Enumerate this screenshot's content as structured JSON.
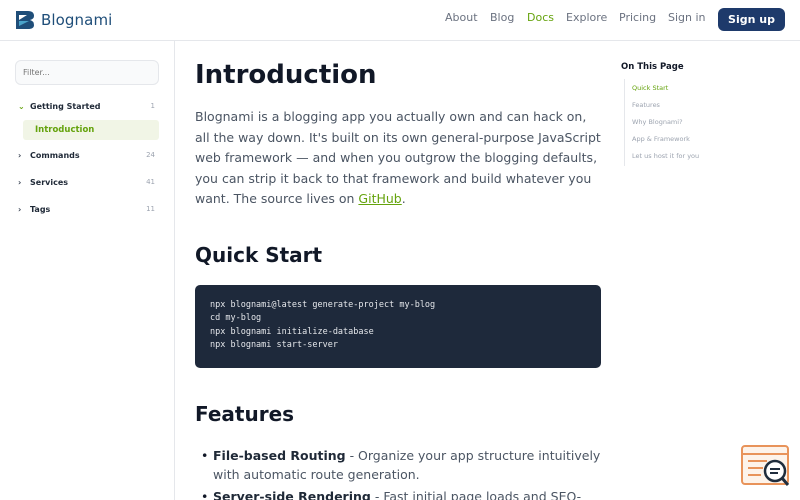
{
  "header": {
    "logo_text": "Blognami",
    "nav": [
      "About",
      "Blog",
      "Docs",
      "Explore",
      "Pricing",
      "Sign in"
    ],
    "active_nav": "Docs",
    "signup_label": "Sign up"
  },
  "sidebar": {
    "filter_placeholder": "Filter...",
    "items": [
      {
        "label": "Getting Started",
        "count": "1"
      },
      {
        "label": "Commands",
        "count": "24"
      },
      {
        "label": "Services",
        "count": "41"
      },
      {
        "label": "Tags",
        "count": "11"
      }
    ],
    "sub_item": "Introduction"
  },
  "main": {
    "title": "Introduction",
    "intro_text": "Blognami is a blogging app you actually own and can hack on, all the way down. It's built on its own general-purpose JavaScript web framework — and when you outgrow the blogging defaults, you can strip it back to that framework and build whatever you want. The source lives on ",
    "intro_link": "GitHub",
    "intro_end": ".",
    "quick_start_heading": "Quick Start",
    "code_lines": [
      "npx blognami@latest generate-project my-blog",
      "cd my-blog",
      "npx blognami initialize-database",
      "npx blognami start-server"
    ],
    "features_heading": "Features",
    "features": [
      {
        "bullet": "•",
        "title": "File-based Routing",
        "desc": " - Organize your app structure intuitively with automatic route generation."
      },
      {
        "bullet": "•",
        "title": "Server-side Rendering",
        "desc": " - Fast initial page loads and SEO-"
      }
    ]
  },
  "toc": {
    "title": "On This Page",
    "items": [
      "Quick Start",
      "Features",
      "Why Blognami?",
      "App & Framework",
      "Let us host it for you"
    ]
  },
  "colors": {
    "brand": "#1e3a6b",
    "accent": "#65a30d",
    "code_bg": "#1e293b"
  },
  "icons": {
    "widget": "search-document-icon",
    "chevron_open": "chevron-down-icon",
    "chevron_closed": "chevron-right-icon"
  }
}
